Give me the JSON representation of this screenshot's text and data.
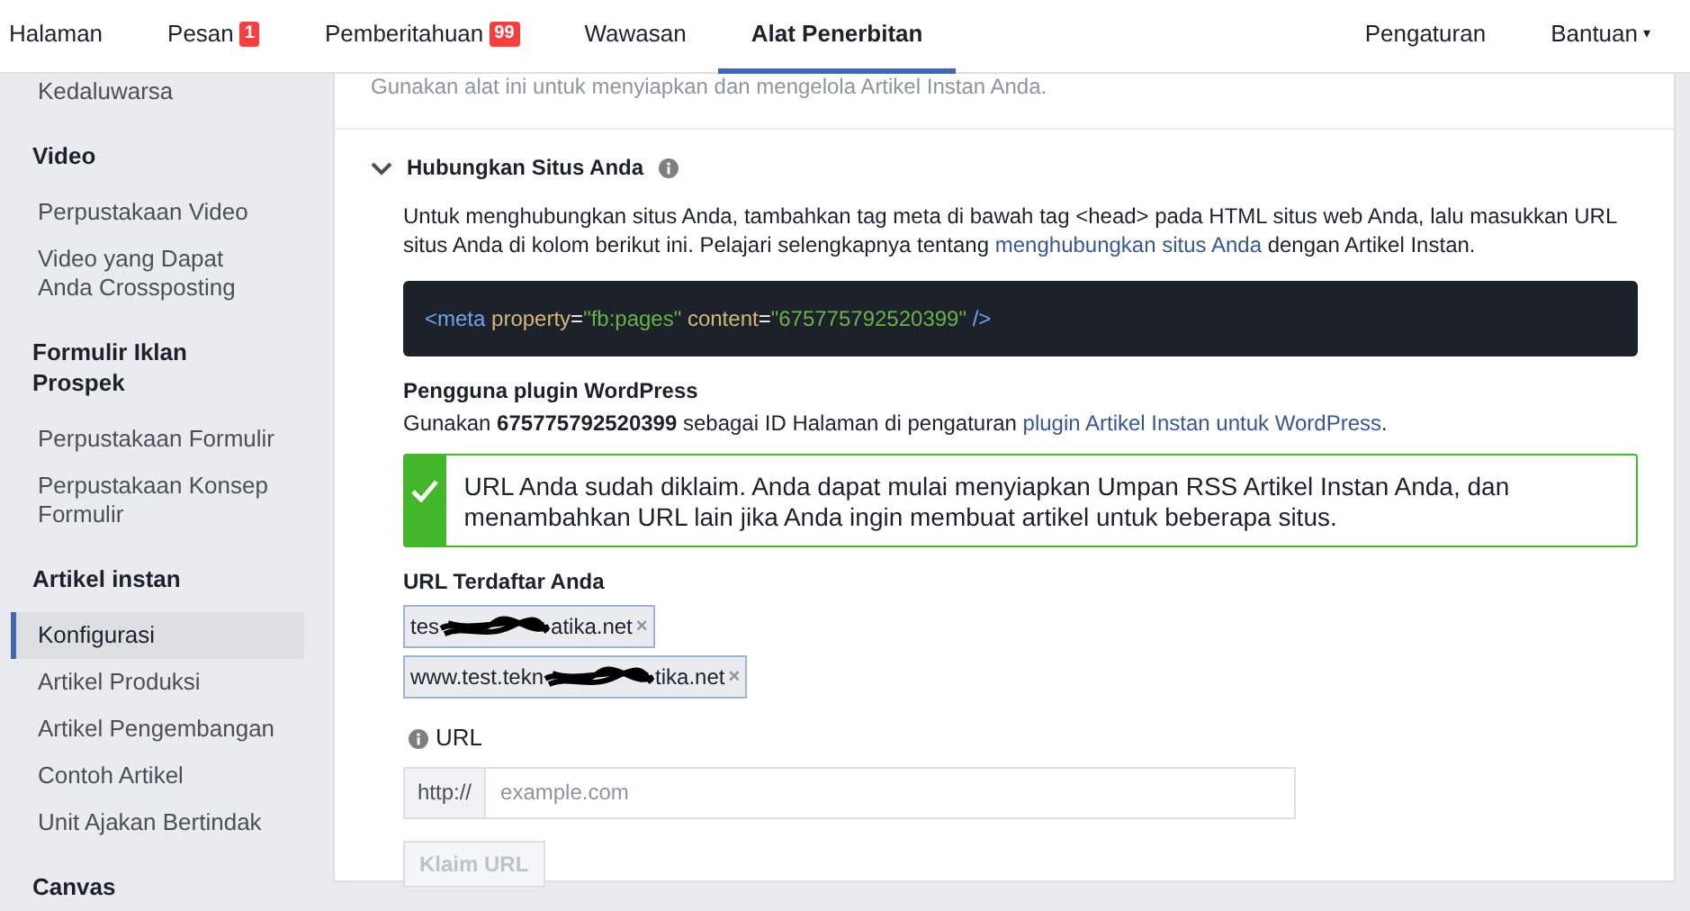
{
  "nav": {
    "left": [
      {
        "label": "Halaman",
        "selected": false
      },
      {
        "label": "Pesan",
        "badge": "1",
        "selected": false
      },
      {
        "label": "Pemberitahuan",
        "badge": "99",
        "selected": false
      },
      {
        "label": "Wawasan",
        "selected": false
      },
      {
        "label": "Alat Penerbitan",
        "selected": true
      }
    ],
    "right": [
      {
        "label": "Pengaturan"
      },
      {
        "label": "Bantuan",
        "caret": "▾"
      }
    ]
  },
  "sidebar": {
    "sections": [
      {
        "items": [
          {
            "label": "Kedaluwarsa",
            "selected": false
          }
        ]
      },
      {
        "title": "Video",
        "items": [
          {
            "label": "Perpustakaan Video",
            "selected": false
          },
          {
            "label": "Video yang Dapat Anda Crossposting",
            "selected": false
          }
        ]
      },
      {
        "title": "Formulir Iklan Prospek",
        "items": [
          {
            "label": "Perpustakaan Formulir",
            "selected": false
          },
          {
            "label": "Perpustakaan Konsep Formulir",
            "selected": false
          }
        ]
      },
      {
        "title": "Artikel instan",
        "items": [
          {
            "label": "Konfigurasi",
            "selected": true
          },
          {
            "label": "Artikel Produksi",
            "selected": false
          },
          {
            "label": "Artikel Pengembangan",
            "selected": false
          },
          {
            "label": "Contoh Artikel",
            "selected": false
          },
          {
            "label": "Unit Ajakan Bertindak",
            "selected": false
          }
        ]
      },
      {
        "title": "Canvas"
      }
    ]
  },
  "main": {
    "intro": "Gunakan alat ini untuk menyiapkan dan mengelola Artikel Instan Anda.",
    "section": {
      "title": "Hubungkan Situs Anda",
      "expanded": true,
      "description": {
        "before": "Untuk menghubungkan situs Anda, tambahkan tag meta di bawah tag <head> pada HTML situs web Anda, lalu masukkan URL situs Anda di kolom berikut ini. Pelajari selengkapnya tentang ",
        "link": "menghubungkan situs Anda",
        "after": " dengan Artikel Instan."
      },
      "code": [
        {
          "text": "<meta",
          "kind": "tag"
        },
        {
          "text": " property",
          "kind": "attr"
        },
        {
          "text": "=",
          "kind": "punct"
        },
        {
          "text": "\"fb:pages\"",
          "kind": "string"
        },
        {
          "text": " content",
          "kind": "attr"
        },
        {
          "text": "=",
          "kind": "punct"
        },
        {
          "text": "\"675775792520399\"",
          "kind": "string"
        },
        {
          "text": " />",
          "kind": "tag"
        }
      ],
      "wordpress": {
        "title": "Pengguna plugin WordPress",
        "text": {
          "before": "Gunakan **675775792520399** sebagai ID Halaman di pengaturan ",
          "link": "plugin Artikel Instan untuk WordPress",
          "after": "."
        }
      },
      "alert": {
        "text": "URL Anda sudah diklaim. Anda dapat mulai menyiapkan Umpan RSS Artikel Instan Anda, dan menambahkan URL lain jika Anda ingin membuat artikel untuk beberapa situs."
      },
      "registered": {
        "label": "URL Terdaftar Anda",
        "urls": [
          {
            "start": "tes",
            "end": "atika.net",
            "remove": "×"
          },
          {
            "start": "www.test.tekn",
            "end": "tika.net",
            "remove": "×"
          }
        ]
      },
      "url_field": {
        "label": "URL",
        "prefix": "http://",
        "placeholder": "example.com"
      },
      "button": {
        "label": "Klaim URL",
        "disabled": true
      }
    }
  }
}
